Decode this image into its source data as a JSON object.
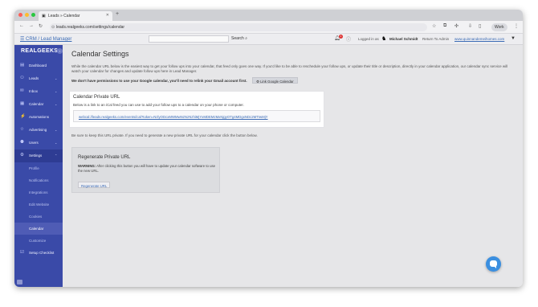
{
  "browser": {
    "tab_title": "Leads » Calendar",
    "tab_icon": "tab-favicon-icon",
    "new_tab": "+",
    "url": "leads.realgeeks.com/settings/calendar",
    "profile_label": "Work",
    "traffic_lights": [
      "#ff5f57",
      "#febc2e",
      "#28c840"
    ]
  },
  "header": {
    "crm_link": "CRM / Lead Manager",
    "search_button": "Search",
    "bell_count": "1",
    "logged_in_as": "Logged in as",
    "user_name": "Michael Schmidt",
    "return_admin": "Return To Admin",
    "site_link": "www.quinnandemeihomes.com"
  },
  "sidebar": {
    "logo": "REALGEEKS",
    "items": [
      {
        "label": "Dashboard",
        "icon": "dashboard-icon",
        "has_chevron": false
      },
      {
        "label": "Leads",
        "icon": "leads-icon",
        "has_chevron": true
      },
      {
        "label": "Inbox",
        "icon": "inbox-icon",
        "has_chevron": true
      },
      {
        "label": "Calendar",
        "icon": "calendar-icon",
        "has_chevron": true
      },
      {
        "label": "Automations",
        "icon": "automations-icon",
        "has_chevron": false
      },
      {
        "label": "Advertising",
        "icon": "advertising-icon",
        "has_chevron": true
      },
      {
        "label": "Users",
        "icon": "users-icon",
        "has_chevron": true
      },
      {
        "label": "Settings",
        "icon": "settings-icon",
        "has_chevron": true
      }
    ],
    "settings_sub": [
      "Profile",
      "Notifications",
      "Integrations",
      "Edit Website",
      "Cookies",
      "Calendar",
      "Customize"
    ],
    "setup_checklist": "Setup Checklist",
    "accent": "#3a4aa8"
  },
  "main": {
    "title": "Calendar Settings",
    "intro": "While the calendar URL below is the easiest way to get your follow ups into your calendar, that feed only goes one way. If you'd like to be able to reschedule your follow ups, or update their title or description, directly in your calendar application, our calendar sync service will watch your calendar for changes and update follow ups here in Lead Manager.",
    "no_permission": "We don't have permissions to use your Google calendar, you'll need to relink your Gmail account first.",
    "link_button": "Link Google Calendar",
    "private_title": "Calendar Private URL",
    "private_text": "Below is a link to an iCal feed you can use to add your follow ups to a calendar on your phone or computer.",
    "feed_url": "webcal://leads.realgeeks.com/events/ical?token=NzlyODcxMWMwNzNzNzhiMjYxMDEMzMxNjgyOTg4MDgxNDc2MTIwMjY",
    "private_note": "Be sure to keep this URL private. If you need to generate a new private URL for your calendar click the button below.",
    "regen_title": "Regenerate Private URL",
    "regen_warning_label": "WARNING:",
    "regen_warning": "After clicking this button you will have to update your calendar software to use the new URL.",
    "regen_button": "Regenerate URL"
  }
}
